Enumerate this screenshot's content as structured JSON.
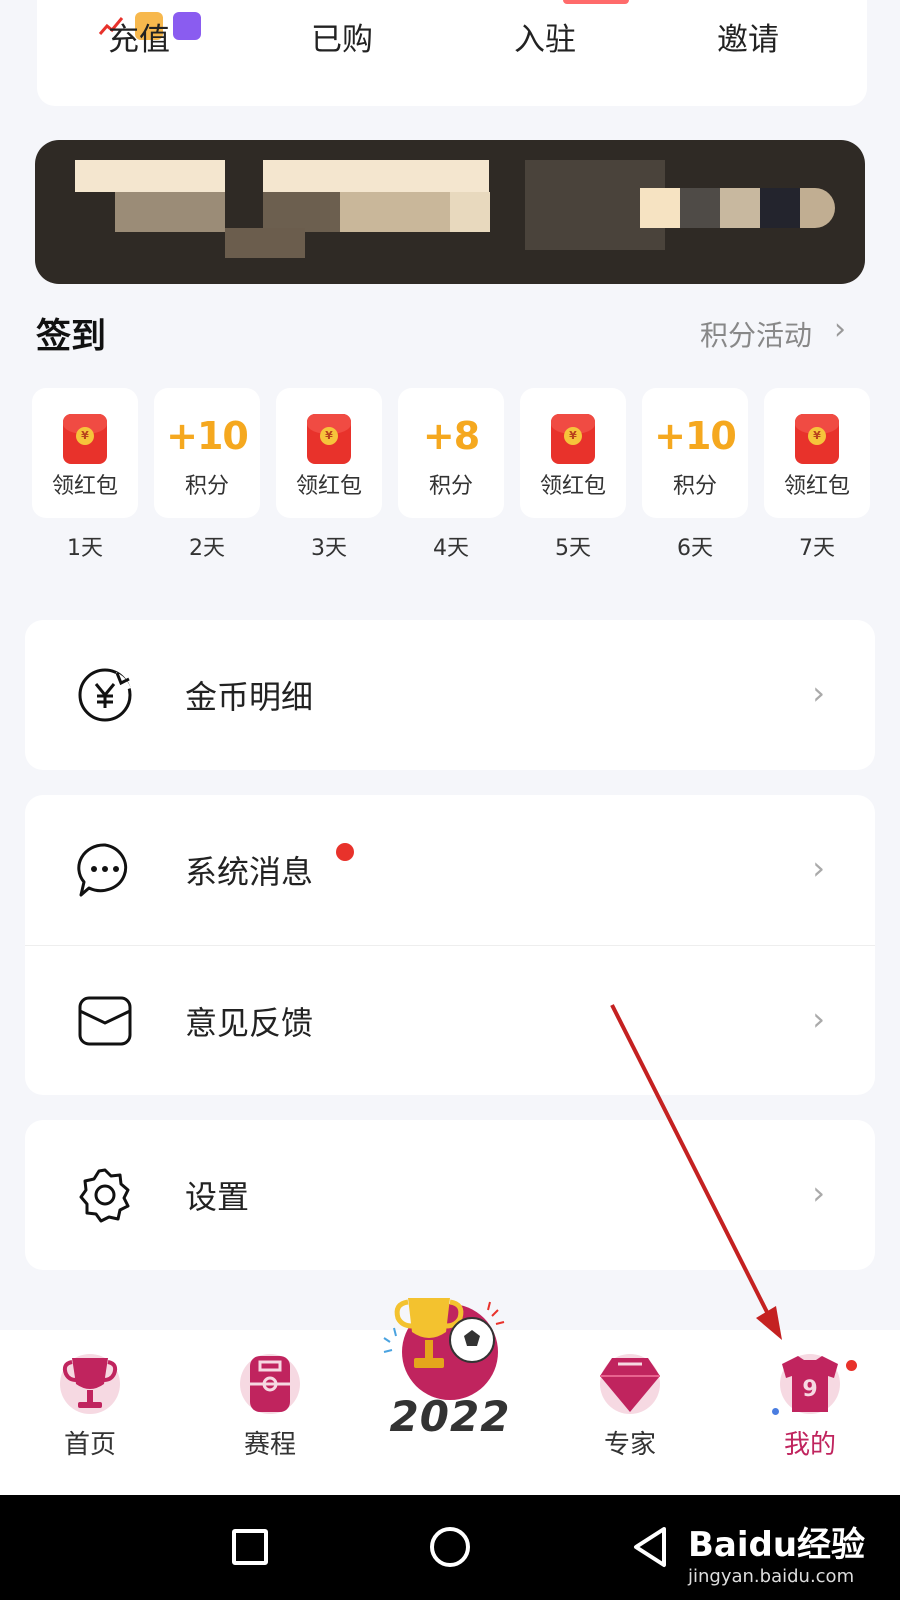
{
  "quick_actions": [
    "充值",
    "已购",
    "入驻",
    "邀请"
  ],
  "checkin": {
    "title": "签到",
    "points_activity": "积分活动",
    "days": [
      {
        "kind": "envelope",
        "label": "领红包",
        "day": "1天"
      },
      {
        "kind": "points",
        "amount": "+10",
        "label": "积分",
        "day": "2天"
      },
      {
        "kind": "envelope",
        "label": "领红包",
        "day": "3天"
      },
      {
        "kind": "points",
        "amount": "+8",
        "label": "积分",
        "day": "4天"
      },
      {
        "kind": "envelope",
        "label": "领红包",
        "day": "5天"
      },
      {
        "kind": "points",
        "amount": "+10",
        "label": "积分",
        "day": "6天"
      },
      {
        "kind": "envelope",
        "label": "领红包",
        "day": "7天"
      }
    ]
  },
  "menu": {
    "coin_detail": "金币明细",
    "system_messages": "系统消息",
    "feedback": "意见反馈",
    "settings": "设置"
  },
  "bottom_nav": {
    "home": "首页",
    "schedule": "赛程",
    "center_badge": "2022",
    "experts": "专家",
    "mine": "我的"
  },
  "watermark": {
    "main": "Baidu经验",
    "sub": "jingyan.baidu.com"
  },
  "colors": {
    "accent": "#c0245e",
    "points": "#f5a81f",
    "red": "#e8322b",
    "background": "#f5f6fa"
  }
}
